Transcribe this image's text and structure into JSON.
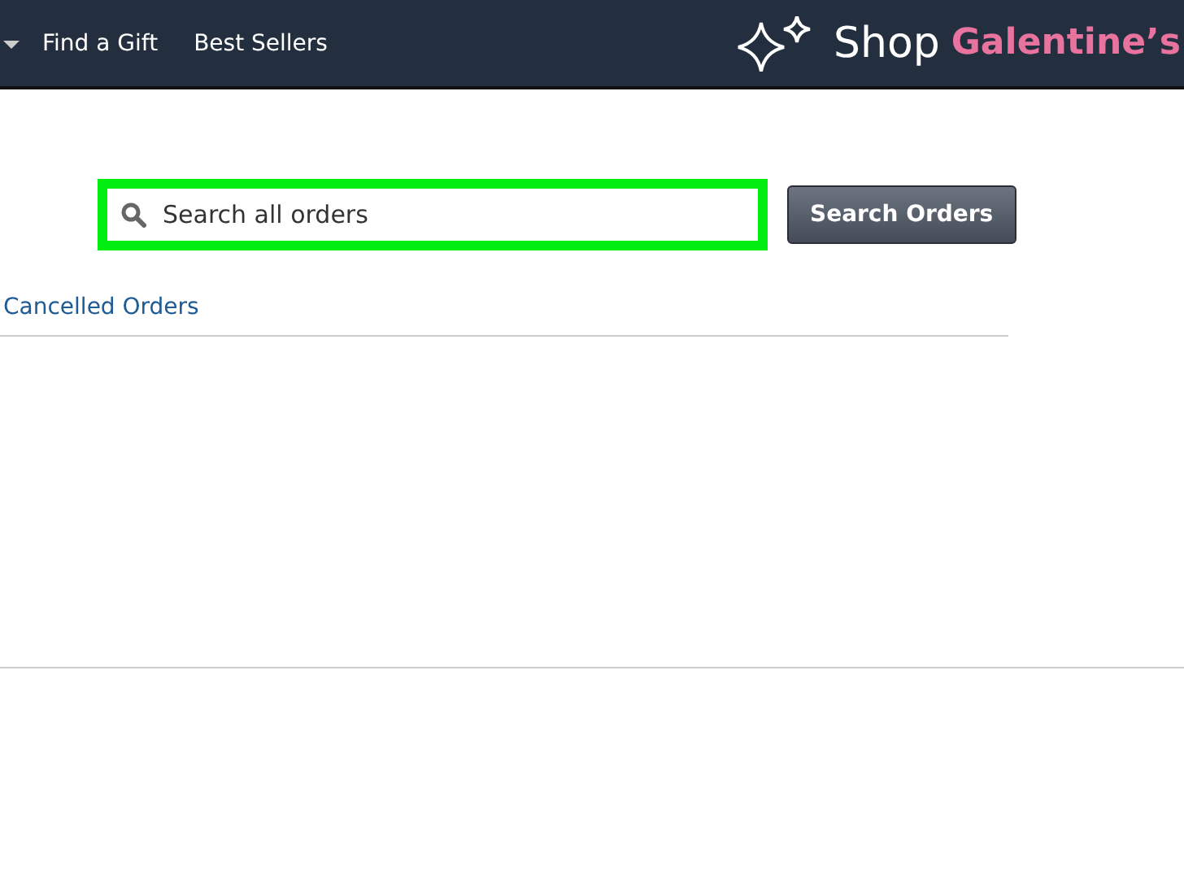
{
  "nav": {
    "items": [
      "Find a Gift",
      "Best Sellers"
    ],
    "promo": {
      "prefix": "Shop",
      "highlight": "Galentine’s"
    }
  },
  "search": {
    "placeholder": "Search all orders",
    "highlighted": true,
    "button": "Search Orders"
  },
  "tabs": [
    {
      "label": "Cancelled Orders",
      "selected": false
    }
  ]
}
